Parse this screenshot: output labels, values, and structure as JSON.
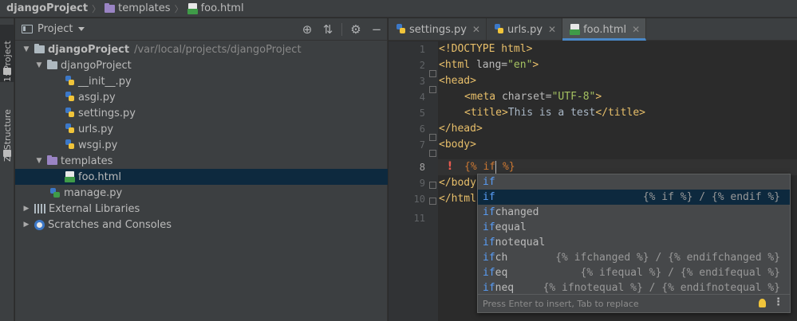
{
  "breadcrumb": {
    "project": "djangoProject",
    "folder": "templates",
    "file": "foo.html"
  },
  "left_stripe": {
    "project_label": "1: Project",
    "structure_label": "Z: Structure"
  },
  "project_panel": {
    "title": "Project",
    "tree": {
      "root": {
        "name": "djangoProject",
        "path": "/var/local/projects/djangoProject"
      },
      "app": {
        "name": "djangoProject",
        "files": [
          "__init__.py",
          "asgi.py",
          "settings.py",
          "urls.py",
          "wsgi.py"
        ]
      },
      "templates": {
        "name": "templates",
        "files": [
          "foo.html"
        ]
      },
      "manage": "manage.py",
      "external": "External Libraries",
      "scratches": "Scratches and Consoles"
    }
  },
  "editor": {
    "tabs": [
      "settings.py",
      "urls.py",
      "foo.html"
    ],
    "active_tab": "foo.html",
    "line_numbers": [
      "1",
      "2",
      "3",
      "4",
      "5",
      "6",
      "7",
      "8",
      "9",
      "10",
      "11"
    ],
    "current_line": "8",
    "code": {
      "l1": "<!DOCTYPE html>",
      "l2_tag": "<html ",
      "l2_attr": "lang=",
      "l2_str": "\"en\"",
      "l2_end": ">",
      "l3": "<head>",
      "l4_tag": "<meta ",
      "l4_attr": "charset=",
      "l4_str": "\"UTF-8\"",
      "l4_end": ">",
      "l5_open": "<title>",
      "l5_text": "This is a test",
      "l5_close": "</title>",
      "l6": "</head>",
      "l7": "<body>",
      "l8_open": "{% ",
      "l8_kw": "if",
      "l8_close": " %}",
      "l9": "</body",
      "l10": "</html"
    }
  },
  "completion": {
    "items": [
      {
        "match": "if",
        "rest": "",
        "tail": ""
      },
      {
        "match": "if",
        "rest": "",
        "tail": "{% if %} / {% endif %}"
      },
      {
        "match": "if",
        "rest": "changed",
        "tail": ""
      },
      {
        "match": "if",
        "rest": "equal",
        "tail": ""
      },
      {
        "match": "if",
        "rest": "notequal",
        "tail": ""
      },
      {
        "match": "if",
        "rest": "ch",
        "tail": "{% ifchanged %} / {% endifchanged %}"
      },
      {
        "match": "if",
        "rest": "eq",
        "tail": "{% ifequal %} / {% endifequal %}"
      },
      {
        "match": "if",
        "rest": "neq",
        "tail": "{% ifnotequal %} / {% endifnotequal %}"
      }
    ],
    "selected_index": 1,
    "footer": "Press Enter to insert, Tab to replace"
  }
}
